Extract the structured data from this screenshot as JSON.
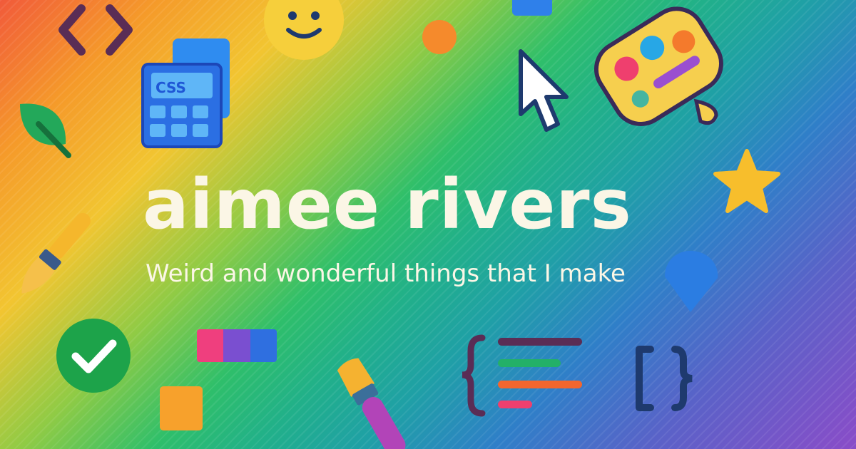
{
  "banner": {
    "title": "aimee rivers",
    "subtitle": "Weird and wonderful things that I make"
  },
  "icons": {
    "css_file_label": "CSS",
    "names": [
      "code-brackets-icon",
      "smiley-face-icon",
      "orange-dot-icon",
      "css-file-icon",
      "cursor-arrow-icon",
      "paint-palette-icon",
      "leaf-icon",
      "star-icon",
      "paintbrush-icon",
      "blue-teardrop-icon",
      "checkmark-icon",
      "color-swatches-icon",
      "orange-square-icon",
      "paintbrush-icon",
      "code-lines-icon",
      "curly-braces-icon"
    ]
  },
  "colors": {
    "title_text": "#fbf6e6",
    "icon_outline": "#5a2d55",
    "gradient": [
      "#f15a3a",
      "#f2c531",
      "#2fbf6a",
      "#2f7fc8",
      "#8a4cc8"
    ]
  }
}
